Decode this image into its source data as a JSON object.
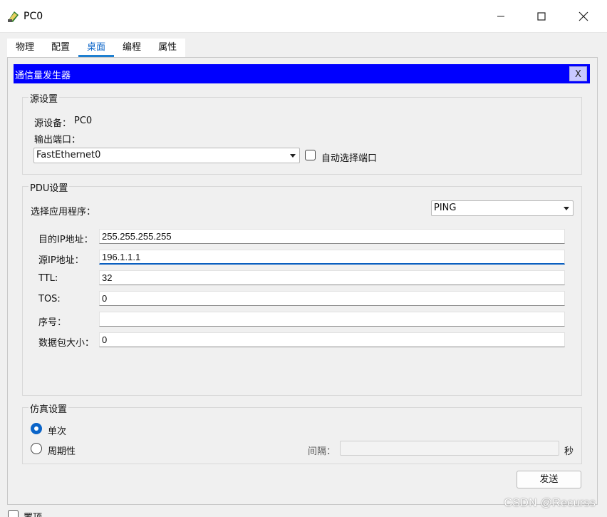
{
  "window": {
    "title": "PC0",
    "icon": "pc-app-icon",
    "controls": [
      "minimize-icon",
      "maximize-icon",
      "close-icon"
    ]
  },
  "tabs": [
    {
      "label": "物理",
      "active": false
    },
    {
      "label": "配置",
      "active": false
    },
    {
      "label": "桌面",
      "active": true
    },
    {
      "label": "编程",
      "active": false
    },
    {
      "label": "属性",
      "active": false
    }
  ],
  "dialog": {
    "title": "通信量发生器",
    "close_label": "X",
    "header_color": "#0000ff"
  },
  "source": {
    "group_label": "源设置",
    "device_label": "源设备：",
    "device_value": "PC0",
    "port_label": "输出端口：",
    "port_selected": "FastEthernet0",
    "auto_port_label": "自动选择端口",
    "auto_port_checked": false
  },
  "pdu": {
    "group_label": "PDU设置",
    "app_label": "选择应用程序：",
    "app_selected": "PING",
    "fields": [
      {
        "label": "目的IP地址：",
        "value": "255.255.255.255"
      },
      {
        "label": "源IP地址：",
        "value": "196.1.1.1"
      },
      {
        "label": "TTL:",
        "value": "32"
      },
      {
        "label": "TOS:",
        "value": "0"
      },
      {
        "label": "序号：",
        "value": ""
      },
      {
        "label": "数据包大小：",
        "value": "0"
      }
    ]
  },
  "simulation": {
    "group_label": "仿真设置",
    "once_label": "单次",
    "once_checked": true,
    "periodic_label": "周期性",
    "periodic_checked": false,
    "interval_label": "间隔：",
    "interval_value": "",
    "unit_label": "秒"
  },
  "send_button": "发送",
  "bottom": {
    "topmost_label": "置顶"
  },
  "watermark": "CSDN @Recurss",
  "colors": {
    "accent": "#0a64c8",
    "header": "#0000ff",
    "close_bg": "#c8c8ff"
  }
}
